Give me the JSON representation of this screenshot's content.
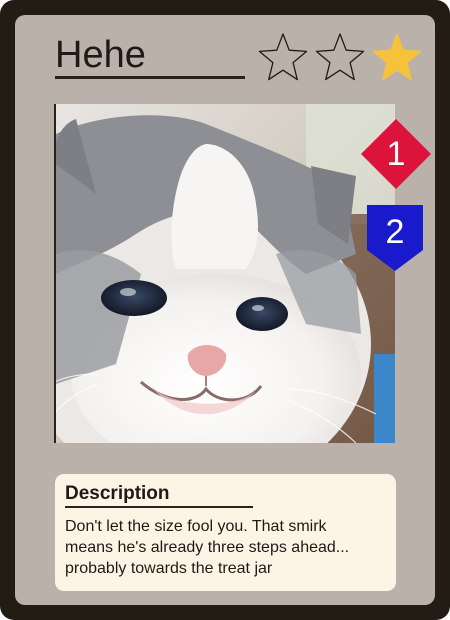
{
  "card": {
    "title": "Hehe",
    "rating": {
      "max": 3,
      "value": 1,
      "filled_color": "#f6c23c",
      "empty_color": "#bab2aa",
      "outline_color": "#1f1a16"
    },
    "image": {
      "subject": "kitten-photo",
      "icon": "kitten-photo-icon"
    },
    "badges": [
      {
        "value": "1",
        "shape": "diamond",
        "color": "#dc143c",
        "icon": "diamond-badge-icon"
      },
      {
        "value": "2",
        "shape": "shield",
        "color": "#1a1acd",
        "icon": "shield-badge-icon"
      }
    ],
    "description": {
      "heading": "Description",
      "lines": [
        "Don't let the size fool you. That smirk",
        "means he's already three steps ahead...",
        "probably towards the treat jar"
      ]
    },
    "colors": {
      "frame": "#231c14",
      "panel": "#bab2aa",
      "description_bg": "#fdf4e6",
      "text": "#1f1a16"
    }
  }
}
